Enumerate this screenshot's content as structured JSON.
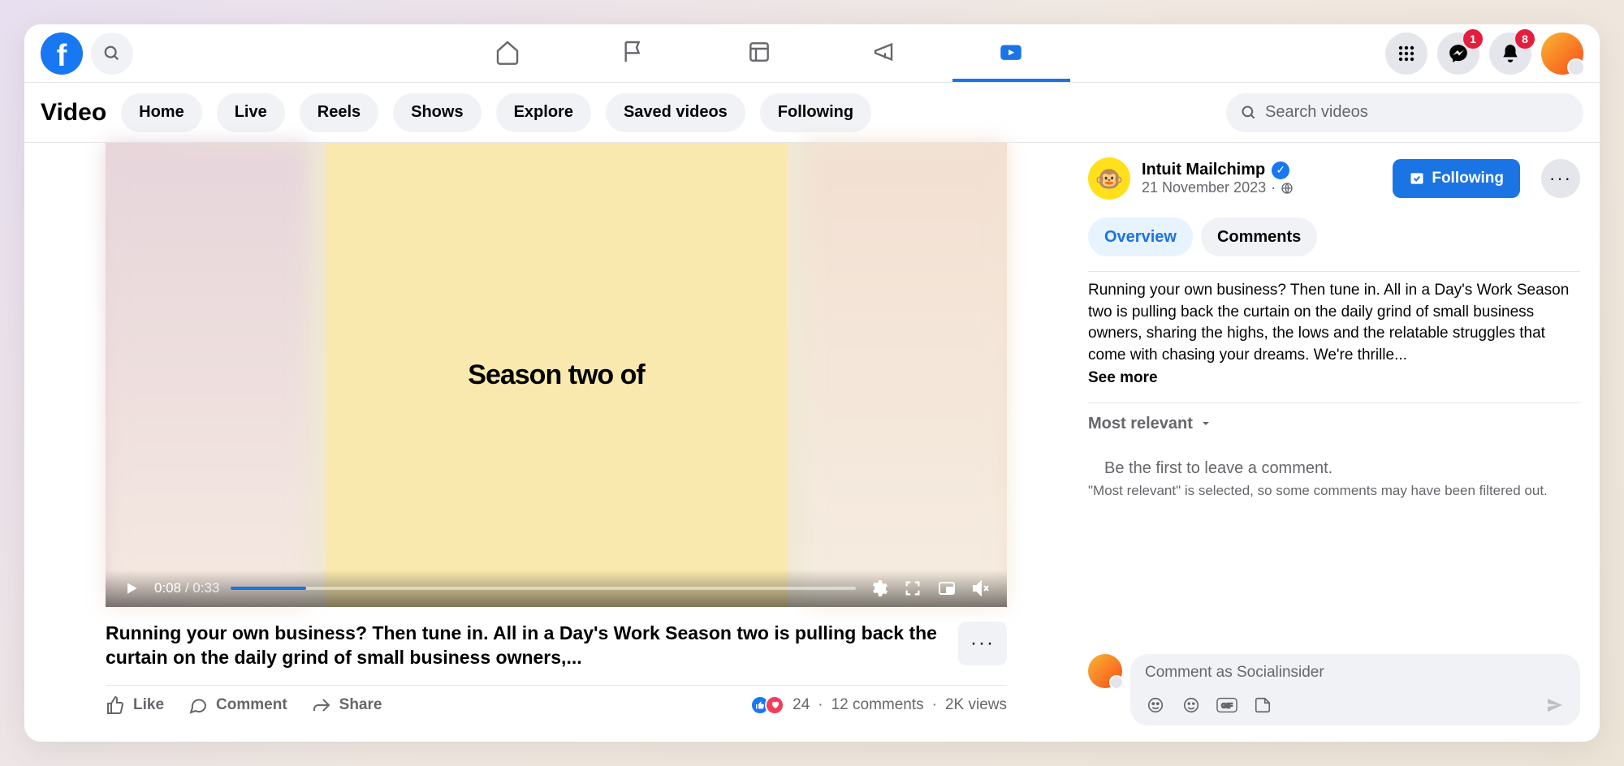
{
  "topnav": {
    "badges": {
      "messenger": "1",
      "notifications": "8"
    }
  },
  "subbar": {
    "title": "Video",
    "filters": [
      "Home",
      "Live",
      "Reels",
      "Shows",
      "Explore",
      "Saved videos",
      "Following"
    ],
    "search_placeholder": "Search videos"
  },
  "video": {
    "overlay_text": "Season two of",
    "current_time": "0:08",
    "duration": "0:33",
    "caption": "Running your own business? Then tune in. All in a Day's Work Season two is pulling back the curtain on the daily grind of small business owners,..."
  },
  "actions": {
    "like": "Like",
    "comment": "Comment",
    "share": "Share",
    "react_count": "24",
    "comments_count": "12 comments",
    "views": "2K views"
  },
  "post": {
    "page_name": "Intuit Mailchimp",
    "date": "21 November 2023",
    "follow_label": "Following",
    "tabs": {
      "overview": "Overview",
      "comments": "Comments"
    },
    "description": "Running your own business? Then tune in. All in a Day's Work Season two is pulling back the curtain on the daily grind of small business owners, sharing the highs, the lows and the relatable struggles that come with chasing your dreams. We're thrille...",
    "see_more": "See more"
  },
  "comments": {
    "sort": "Most relevant",
    "empty": "Be the first to leave a comment.",
    "filter_note": "\"Most relevant\" is selected, so some comments may have been filtered out.",
    "placeholder": "Comment as Socialinsider"
  }
}
